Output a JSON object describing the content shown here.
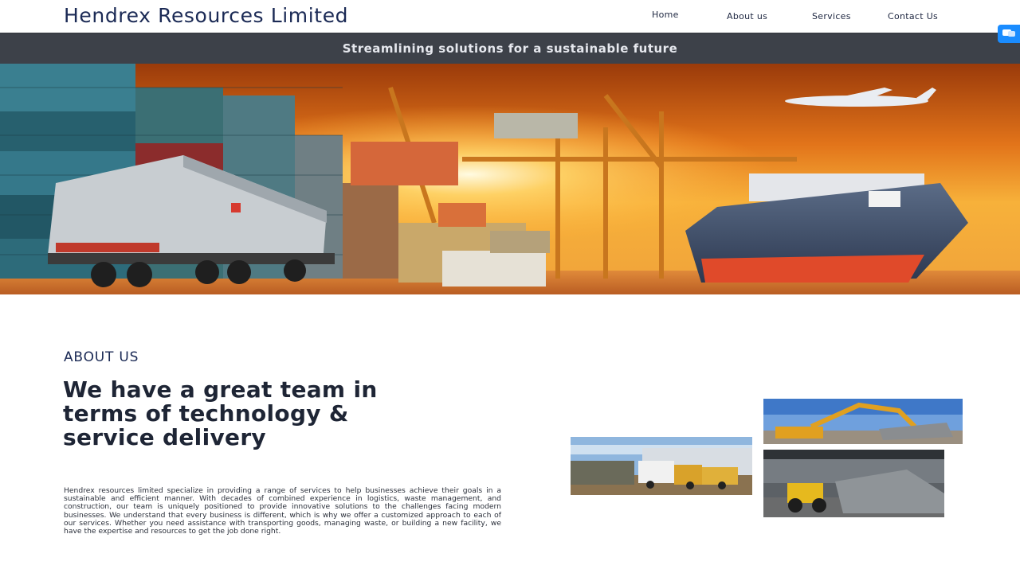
{
  "header": {
    "brand": "Hendrex Resources Limited",
    "nav": {
      "home": "Home",
      "about": "About us",
      "services": "Services",
      "contact": "Contact Us"
    }
  },
  "banner": {
    "tagline": "Streamlining solutions for a sustainable future"
  },
  "about": {
    "label": "ABOUT US",
    "heading": "We have a great team in terms of technology & service delivery",
    "body": "Hendrex resources limited specialize in providing a range of services to help businesses achieve their goals in a sustainable and efficient manner. With decades of combined experience in logistics, waste management, and construction, our team is uniquely positioned to provide innovative solutions to the challenges facing modern businesses. We understand that every business is different, which is why we offer a customized approach to each of our services. Whether you need assistance with transporting goods, managing waste, or building a new facility, we have the expertise and resources to get the job done right."
  },
  "colors": {
    "brand": "#1b2a55",
    "tagline_bar": "#3d4149",
    "chat_widget": "#1a8cff"
  },
  "icons": {
    "chat": "chat-icon"
  }
}
